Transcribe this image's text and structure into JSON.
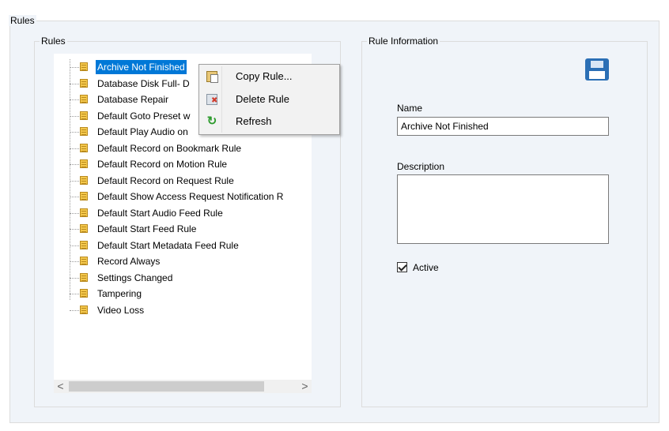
{
  "outer_group": {
    "title": "Rules"
  },
  "rules_group": {
    "title": "Rules",
    "items": [
      "Archive Not Finished",
      "Database Disk Full- D",
      "Database Repair",
      "Default Goto Preset w",
      "Default Play Audio on",
      "Default Record on Bookmark Rule",
      "Default Record on Motion Rule",
      "Default Record on Request Rule",
      "Default Show Access Request Notification R",
      "Default Start Audio Feed Rule",
      "Default Start Feed Rule",
      "Default Start Metadata Feed Rule",
      "Record Always",
      "Settings Changed",
      "Tampering",
      "Video Loss"
    ],
    "selected_index": 0,
    "scroll_left_glyph": "<",
    "scroll_right_glyph": ">"
  },
  "context_menu": {
    "items": [
      {
        "label": "Copy Rule...",
        "icon": "copy-rule-icon"
      },
      {
        "label": "Delete Rule",
        "icon": "delete-rule-icon"
      },
      {
        "label": "Refresh",
        "icon": "refresh-icon"
      }
    ]
  },
  "rule_info": {
    "title": "Rule Information",
    "save_icon": "save-icon",
    "name_label": "Name",
    "name_value": "Archive Not Finished",
    "description_label": "Description",
    "description_value": "",
    "active_label": "Active",
    "active_checked": true
  },
  "colors": {
    "selection": "#0078d7",
    "panel_background": "#f0f4f9",
    "save_icon": "#2b6fb5"
  }
}
